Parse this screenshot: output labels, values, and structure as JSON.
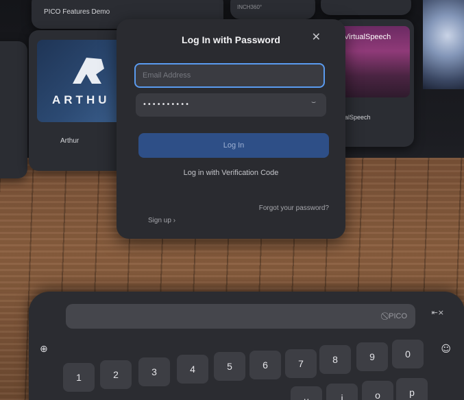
{
  "background_cards": {
    "features_demo_label": "PICO Features Demo",
    "inch_label": "INCH360°",
    "arthur_wordmark": "ARTHU",
    "arthur_label": "Arthur",
    "virtualspeech_wordmark": "VirtualSpeech",
    "virtualspeech_label": "ualSpeech"
  },
  "dialog": {
    "title": "Log In with Password",
    "close_glyph": "✕",
    "email_placeholder": "Email Address",
    "password_mask": "••••••••••",
    "eye_glyph": "⌣",
    "login_label": "Log In",
    "verification_link": "Log in with Verification Code",
    "signup_label": "Sign up ›",
    "forgot_label": "Forgot your password?"
  },
  "keyboard": {
    "brand": "⃠ PICO",
    "clear_glyph": "⇤×",
    "globe_glyph": "⊕",
    "emoji_glyph": "☺",
    "row1": [
      "1",
      "2",
      "3",
      "4",
      "5",
      "6",
      "7",
      "8",
      "9",
      "0"
    ],
    "row2": [
      "u",
      "i",
      "o",
      "p"
    ]
  },
  "colors": {
    "accent": "#5a9bf0",
    "login_button": "#2e4f87",
    "dialog_bg": "#2a2b30"
  }
}
